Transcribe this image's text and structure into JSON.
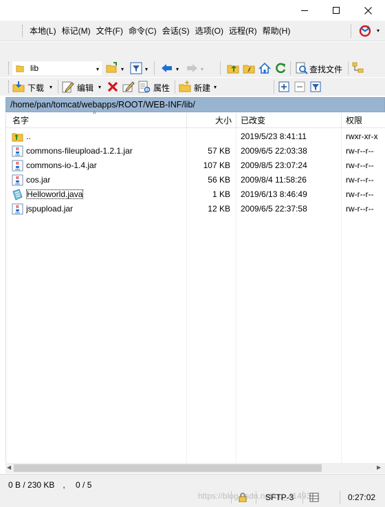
{
  "menu": {
    "items": [
      "本地(L)",
      "标记(M)",
      "文件(F)",
      "命令(C)",
      "会话(S)",
      "选项(O)",
      "远程(R)",
      "帮助(H)"
    ]
  },
  "toolbar1": {
    "location_value": "lib",
    "find_files_label": "查找文件"
  },
  "toolbar2": {
    "download_label": "下载",
    "edit_label": "编辑",
    "properties_label": "属性",
    "new_label": "新建"
  },
  "path": "/home/pan/tomcat/webapps/ROOT/WEB-INF/lib/",
  "columns": {
    "name": "名字",
    "size": "大小",
    "changed": "已改变",
    "rights": "权限"
  },
  "files": [
    {
      "name": "..",
      "size": "",
      "changed": "2019/5/23 8:41:11",
      "rights": "rwxr-xr-x",
      "icon": "parent-folder-icon"
    },
    {
      "name": "commons-fileupload-1.2.1.jar",
      "size": "57 KB",
      "changed": "2009/6/5 22:03:38",
      "rights": "rw-r--r--",
      "icon": "jar-file-icon"
    },
    {
      "name": "commons-io-1.4.jar",
      "size": "107 KB",
      "changed": "2009/8/5 23:07:24",
      "rights": "rw-r--r--",
      "icon": "jar-file-icon"
    },
    {
      "name": "cos.jar",
      "size": "56 KB",
      "changed": "2009/8/4 11:58:26",
      "rights": "rw-r--r--",
      "icon": "jar-file-icon"
    },
    {
      "name": "Helloworld.java",
      "size": "1 KB",
      "changed": "2019/6/13 8:46:49",
      "rights": "rw-r--r--",
      "icon": "java-file-icon"
    },
    {
      "name": "jspupload.jar",
      "size": "12 KB",
      "changed": "2009/6/5 22:37:58",
      "rights": "rw-r--r--",
      "icon": "jar-file-icon"
    }
  ],
  "status": {
    "selection": "0 B / 230 KB　, 　0 / 5",
    "protocol": "SFTP-3",
    "time": "0:27:02",
    "watermark": "https://blog.csdn.net/qq_4149391"
  },
  "colors": {
    "path_bar_bg": "#99b4d1",
    "toolbar_bg": "#f0f0f0",
    "accent_blue": "#1e6fd0",
    "delete_red": "#d4151c"
  }
}
